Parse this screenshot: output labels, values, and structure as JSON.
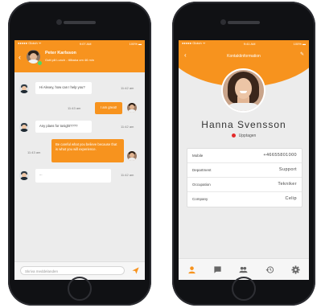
{
  "colors": {
    "accent": "#f7931e",
    "status_busy": "#e32b2b",
    "online": "#4cd964"
  },
  "chat": {
    "statusbar": {
      "carrier": "●●●●● Glotch ᯤ",
      "time": "9:07 AM",
      "battery": "100% ▬"
    },
    "header": {
      "back_icon": "back-arrow-icon",
      "name": "Peter Karlsson",
      "subtitle": "Gott på Lunch - tillbaka om 46 min"
    },
    "messages": [
      {
        "direction": "in",
        "text": "Hi Alexey, how can I help you?",
        "time": "11:42 am"
      },
      {
        "direction": "out",
        "text": "I am great!",
        "time": "11:43 am"
      },
      {
        "direction": "in",
        "text": "Any plans for tonight????",
        "time": "11:42 am"
      },
      {
        "direction": "out",
        "text": "Be careful what you believe because that is what you will experience.",
        "time": "11:43 am"
      },
      {
        "direction": "in",
        "text": "...",
        "time": "11:42 am"
      }
    ],
    "input": {
      "placeholder": "Skriva meddelanden",
      "send_icon": "send-icon"
    }
  },
  "contact": {
    "statusbar": {
      "carrier": "●●●●● Glotch ᯤ",
      "time": "9:41 AM",
      "battery": "100% ▬"
    },
    "header": {
      "title": "Kontaktinformation",
      "back_icon": "back-arrow-icon",
      "edit_icon": "pencil-icon"
    },
    "name": "Hanna Svensson",
    "status": "Upptagen",
    "fields": [
      {
        "label": "Mobile",
        "value": "+46655801000"
      },
      {
        "label": "Department",
        "value": "Support"
      },
      {
        "label": "Occupation",
        "value": "Tekniker"
      },
      {
        "label": "Company",
        "value": "Celip"
      }
    ],
    "tabs": [
      "person-icon",
      "chat-bubble-icon",
      "group-icon",
      "history-icon",
      "gear-icon"
    ]
  }
}
